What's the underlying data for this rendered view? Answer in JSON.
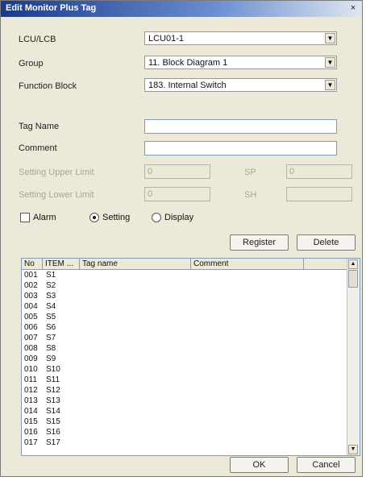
{
  "window": {
    "title": "Edit Monitor Plus Tag",
    "close_glyph": "×"
  },
  "form": {
    "lcu_label": "LCU/LCB",
    "lcu_value": "LCU01-1",
    "group_label": "Group",
    "group_value": "11. Block Diagram 1",
    "fb_label": "Function Block",
    "fb_value": "183. Internal Switch",
    "tag_name_label": "Tag Name",
    "tag_name_value": "",
    "comment_label": "Comment",
    "comment_value": "",
    "upper_label": "Setting Upper Limit",
    "upper_value": "0",
    "lower_label": "Setting Lower Limit",
    "lower_value": "0",
    "sp_label": "SP",
    "sp_value": "0",
    "sh_label": "SH",
    "sh_value": ""
  },
  "options": {
    "alarm_label": "Alarm",
    "setting_label": "Setting",
    "display_label": "Display",
    "selected": "Setting"
  },
  "buttons": {
    "register": "Register",
    "delete": "Delete",
    "ok": "OK",
    "cancel": "Cancel"
  },
  "table": {
    "columns": [
      "No",
      "ITEM ...",
      "Tag name",
      "Comment"
    ],
    "rows": [
      [
        "001",
        "S1"
      ],
      [
        "002",
        "S2"
      ],
      [
        "003",
        "S3"
      ],
      [
        "004",
        "S4"
      ],
      [
        "005",
        "S5"
      ],
      [
        "006",
        "S6"
      ],
      [
        "007",
        "S7"
      ],
      [
        "008",
        "S8"
      ],
      [
        "009",
        "S9"
      ],
      [
        "010",
        "S10"
      ],
      [
        "011",
        "S11"
      ],
      [
        "012",
        "S12"
      ],
      [
        "013",
        "S13"
      ],
      [
        "014",
        "S14"
      ],
      [
        "015",
        "S15"
      ],
      [
        "016",
        "S16"
      ],
      [
        "017",
        "S17"
      ]
    ]
  },
  "icons": {
    "combo_arrow": "▼",
    "scroll_up": "▲",
    "scroll_down": "▼"
  }
}
